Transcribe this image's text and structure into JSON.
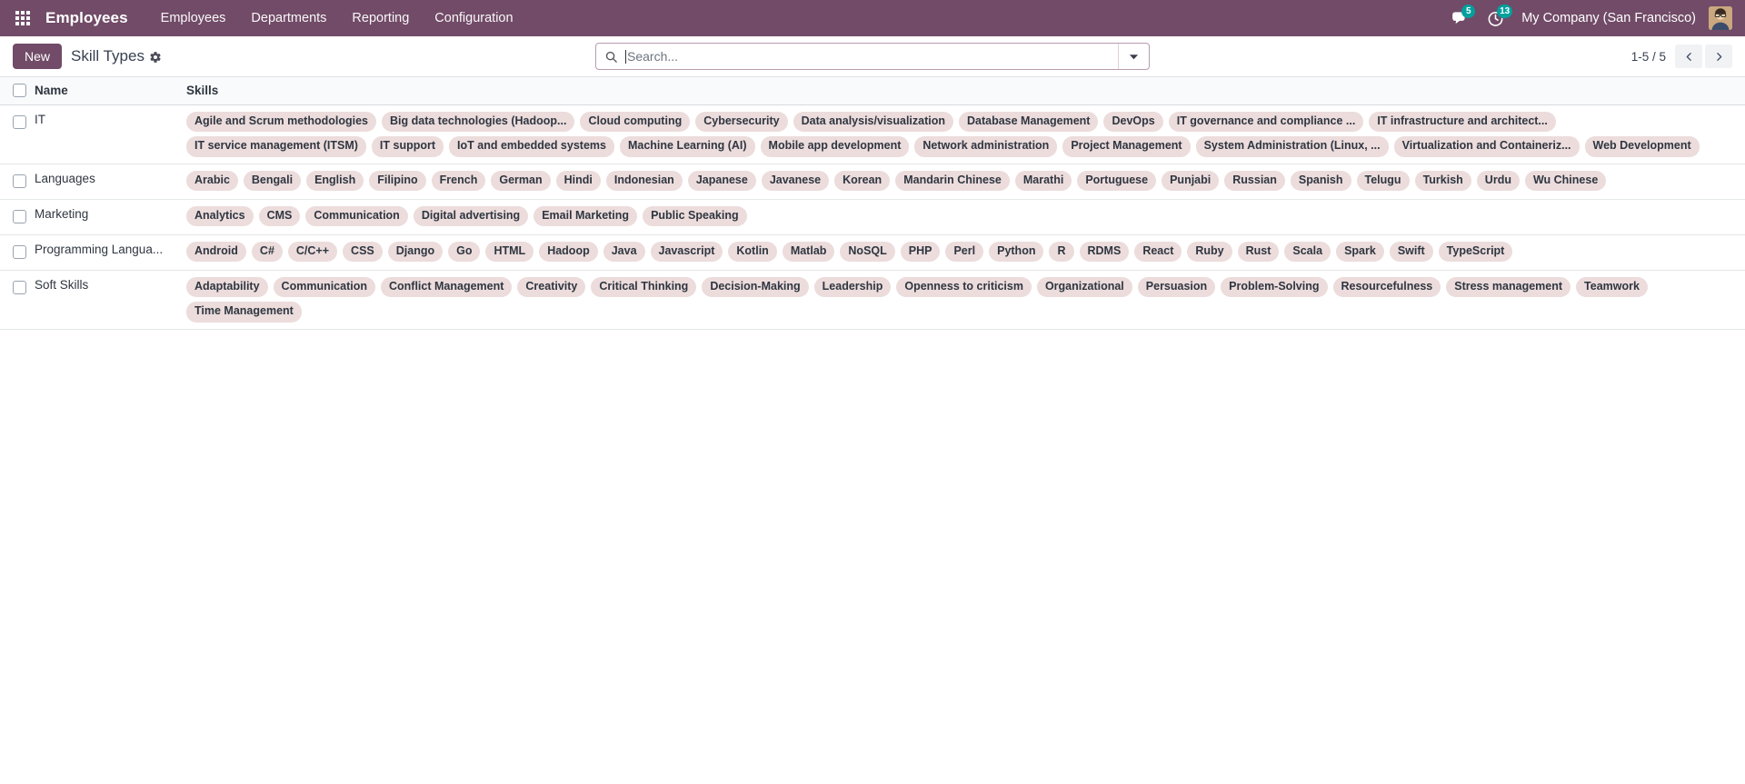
{
  "navbar": {
    "apps_icon": "apps-grid-icon",
    "brand": "Employees",
    "menu_items": [
      {
        "label": "Employees"
      },
      {
        "label": "Departments"
      },
      {
        "label": "Reporting"
      },
      {
        "label": "Configuration"
      }
    ],
    "messages_icon": "chat-bubble-icon",
    "messages_count": "5",
    "activities_icon": "clock-activity-icon",
    "activities_count": "13",
    "company": "My Company (San Francisco)",
    "avatar_icon": "user-avatar",
    "bg_color": "#714B67"
  },
  "control_panel": {
    "new_label": "New",
    "title": "Skill Types",
    "gear_icon": "gear-icon",
    "search": {
      "icon": "search-icon",
      "placeholder": "Search...",
      "value": "",
      "toggle_icon": "chevron-down-icon"
    },
    "pager": {
      "count": "1-5 / 5",
      "prev_icon": "chevron-left-icon",
      "next_icon": "chevron-right-icon"
    }
  },
  "table": {
    "columns": {
      "name": "Name",
      "skills": "Skills"
    },
    "tag_color": "#ecdcdc",
    "rows": [
      {
        "name": "IT",
        "skills": [
          "Agile and Scrum methodologies",
          "Big data technologies (Hadoop...",
          "Cloud computing",
          "Cybersecurity",
          "Data analysis/visualization",
          "Database Management",
          "DevOps",
          "IT governance and compliance ...",
          "IT infrastructure and architect...",
          "IT service management (ITSM)",
          "IT support",
          "IoT and embedded systems",
          "Machine Learning (AI)",
          "Mobile app development",
          "Network administration",
          "Project Management",
          "System Administration (Linux, ...",
          "Virtualization and Containeriz...",
          "Web Development"
        ]
      },
      {
        "name": "Languages",
        "skills": [
          "Arabic",
          "Bengali",
          "English",
          "Filipino",
          "French",
          "German",
          "Hindi",
          "Indonesian",
          "Japanese",
          "Javanese",
          "Korean",
          "Mandarin Chinese",
          "Marathi",
          "Portuguese",
          "Punjabi",
          "Russian",
          "Spanish",
          "Telugu",
          "Turkish",
          "Urdu",
          "Wu Chinese"
        ]
      },
      {
        "name": "Marketing",
        "skills": [
          "Analytics",
          "CMS",
          "Communication",
          "Digital advertising",
          "Email Marketing",
          "Public Speaking"
        ]
      },
      {
        "name": "Programming Langua...",
        "skills": [
          "Android",
          "C#",
          "C/C++",
          "CSS",
          "Django",
          "Go",
          "HTML",
          "Hadoop",
          "Java",
          "Javascript",
          "Kotlin",
          "Matlab",
          "NoSQL",
          "PHP",
          "Perl",
          "Python",
          "R",
          "RDMS",
          "React",
          "Ruby",
          "Rust",
          "Scala",
          "Spark",
          "Swift",
          "TypeScript"
        ]
      },
      {
        "name": "Soft Skills",
        "skills": [
          "Adaptability",
          "Communication",
          "Conflict Management",
          "Creativity",
          "Critical Thinking",
          "Decision-Making",
          "Leadership",
          "Openness to criticism",
          "Organizational",
          "Persuasion",
          "Problem-Solving",
          "Resourcefulness",
          "Stress management",
          "Teamwork",
          "Time Management"
        ]
      }
    ]
  }
}
